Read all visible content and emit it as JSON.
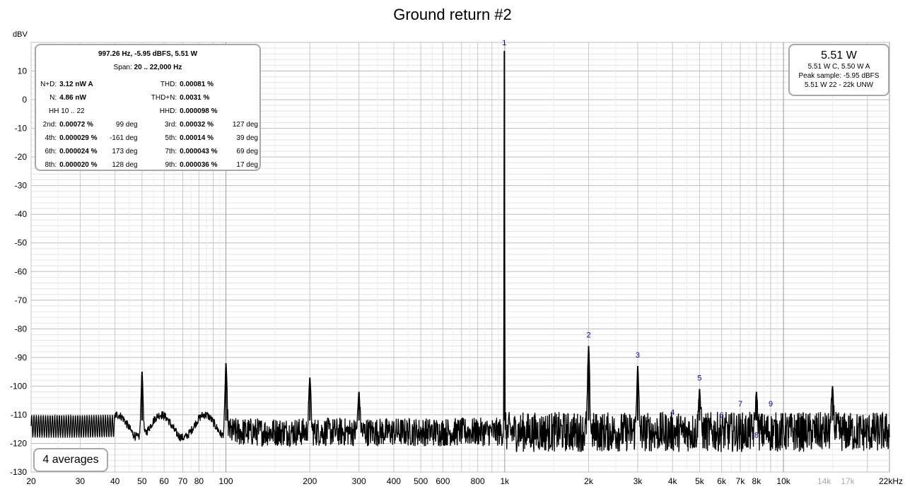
{
  "chart_data": {
    "type": "line",
    "title": "Ground return #2",
    "ylabel": "dBV",
    "x_scale": "log",
    "xlim": [
      20,
      24000
    ],
    "ylim": [
      -130,
      20
    ],
    "grid": true,
    "yticks": [
      10,
      0,
      -10,
      -20,
      -30,
      -40,
      -50,
      -60,
      -70,
      -80,
      -90,
      -100,
      -110,
      -120,
      -130
    ],
    "xticks": [
      {
        "v": 20,
        "label": "20"
      },
      {
        "v": 30,
        "label": "30"
      },
      {
        "v": 40,
        "label": "40"
      },
      {
        "v": 50,
        "label": "50"
      },
      {
        "v": 60,
        "label": "60"
      },
      {
        "v": 70,
        "label": "70"
      },
      {
        "v": 80,
        "label": "80"
      },
      {
        "v": 100,
        "label": "100"
      },
      {
        "v": 200,
        "label": "200"
      },
      {
        "v": 300,
        "label": "300"
      },
      {
        "v": 400,
        "label": "400"
      },
      {
        "v": 500,
        "label": "500"
      },
      {
        "v": 600,
        "label": "600"
      },
      {
        "v": 800,
        "label": "800"
      },
      {
        "v": 1000,
        "label": "1k"
      },
      {
        "v": 2000,
        "label": "2k"
      },
      {
        "v": 3000,
        "label": "3k"
      },
      {
        "v": 4000,
        "label": "4k"
      },
      {
        "v": 5000,
        "label": "5k"
      },
      {
        "v": 6000,
        "label": "6k"
      },
      {
        "v": 7000,
        "label": "7k"
      },
      {
        "v": 8000,
        "label": "8k"
      },
      {
        "v": 10000,
        "label": "10k"
      },
      {
        "v": 14000,
        "label": "14k",
        "faint": true
      },
      {
        "v": 17000,
        "label": "17k",
        "faint": true
      },
      {
        "v": 22000,
        "label": "22kHz"
      }
    ],
    "peaks": [
      {
        "f": 50,
        "db": -95
      },
      {
        "f": 100,
        "db": -92
      },
      {
        "f": 200,
        "db": -97
      },
      {
        "f": 300,
        "db": -102
      },
      {
        "f": 997.26,
        "db": 17
      },
      {
        "f": 2000,
        "db": -86
      },
      {
        "f": 3000,
        "db": -93
      },
      {
        "f": 5000,
        "db": -101
      },
      {
        "f": 8000,
        "db": -102
      },
      {
        "f": 15000,
        "db": -100
      }
    ],
    "harmonic_markers": [
      {
        "label": "1",
        "f": 997.26,
        "db": 19
      },
      {
        "label": "2",
        "f": 2000,
        "db": -83
      },
      {
        "label": "3",
        "f": 3000,
        "db": -90
      },
      {
        "label": "4",
        "f": 4000,
        "db": -110
      },
      {
        "label": "5",
        "f": 5000,
        "db": -98
      },
      {
        "label": "6",
        "f": 6000,
        "db": -111
      },
      {
        "label": "7",
        "f": 7000,
        "db": -107
      },
      {
        "label": "8",
        "f": 8000,
        "db": -118
      },
      {
        "label": "9",
        "f": 9000,
        "db": -107
      }
    ]
  },
  "info": {
    "header1": "997.26 Hz, -5.95 dBFS, 5.51 W",
    "span_label": "Span:",
    "span_value": "20 .. 22,000 Hz",
    "nd_label": "N+D:",
    "nd_value": "3.12 nW A",
    "thd_label": "THD:",
    "thd_value": "0.00081 %",
    "n_label": "N:",
    "n_value": "4.86 nW",
    "thdn_label": "THD+N:",
    "thdn_value": "0.0031 %",
    "hh_label": "HH 10 .. 22",
    "hhd_label": "HHD:",
    "hhd_value": "0.000098 %",
    "harmonics": [
      {
        "l1": "2nd:",
        "v1": "0.00072 %",
        "d1": "99 deg",
        "l2": "3rd:",
        "v2": "0.00032 %",
        "d2": "127 deg"
      },
      {
        "l1": "4th:",
        "v1": "0.000029 %",
        "d1": "-161 deg",
        "l2": "5th:",
        "v2": "0.00014 %",
        "d2": "39 deg"
      },
      {
        "l1": "6th:",
        "v1": "0.000024 %",
        "d1": "173 deg",
        "l2": "7th:",
        "v2": "0.000043 %",
        "d2": "69 deg"
      },
      {
        "l1": "8th:",
        "v1": "0.000020 %",
        "d1": "128 deg",
        "l2": "9th:",
        "v2": "0.000036 %",
        "d2": "17 deg"
      }
    ]
  },
  "power": {
    "main": "5.51 W",
    "line1": "5.51 W C, 5.50 W A",
    "line2": "Peak sample: -5.95 dBFS",
    "line3": "5.51 W 22 - 22k UNW"
  },
  "averages": "4 averages",
  "colors": {
    "grid": "#c8c8c8",
    "major_grid": "#9a9a9a",
    "trace": "#000000",
    "marker": "#0000c0",
    "box_border": "#a8a8a8"
  }
}
